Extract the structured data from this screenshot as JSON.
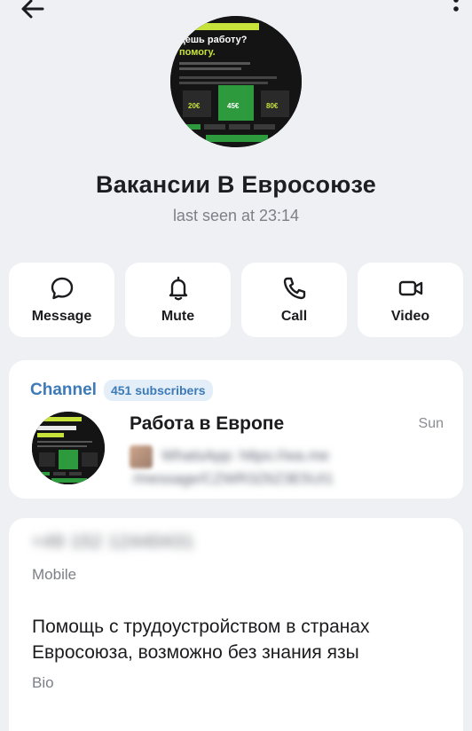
{
  "header": {
    "back_icon": "arrow-left-icon",
    "more_icon": "kebab-menu-icon"
  },
  "profile": {
    "avatar_lines": [
      "цешь работу?",
      "помогу."
    ],
    "avatar_prices": [
      "20€",
      "45€",
      "80€"
    ],
    "name": "Вакансии В Евросоюзе",
    "status": "last seen at 23:14"
  },
  "actions": [
    {
      "label": "Message",
      "icon": "chat-bubble-icon"
    },
    {
      "label": "Mute",
      "icon": "bell-icon"
    },
    {
      "label": "Call",
      "icon": "phone-icon"
    },
    {
      "label": "Video",
      "icon": "video-camera-icon"
    }
  ],
  "channel": {
    "label": "Channel",
    "subscribers": "451 subscribers",
    "name": "Работа в Европе",
    "time": "Sun",
    "preview_line1": "WhatsApp: https://wa.me",
    "preview_line2": "/message/CZWR3Z6Z3E5UI1"
  },
  "info": {
    "phone": "+49 152 12440431",
    "phone_label": "Mobile",
    "bio": "Помощь с трудоустройством в странах Евросоюза, возможно без знания язы",
    "bio_label": "Bio"
  },
  "colors": {
    "accent": "#3c7ab8",
    "background": "#eef0f4",
    "card": "#ffffff",
    "green": "#2e9a3e"
  }
}
